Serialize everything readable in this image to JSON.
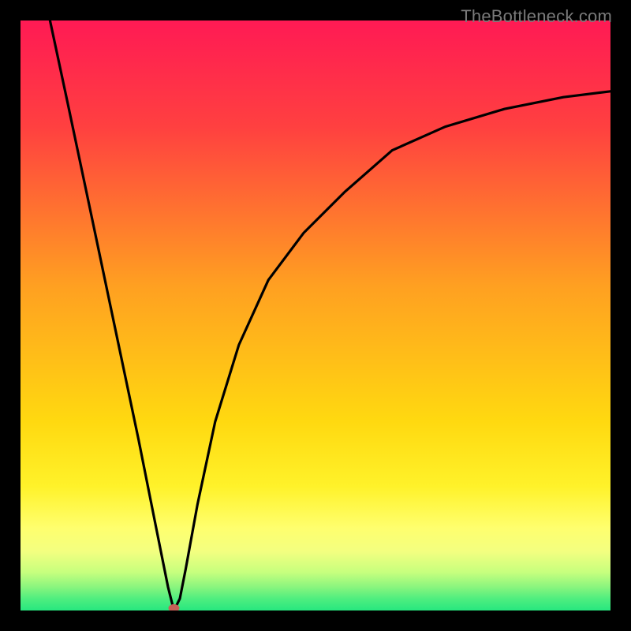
{
  "watermark": "TheBottleneck.com",
  "colors": {
    "frame": "#000000",
    "top_gradient": "#ff1a54",
    "mid_gradient": "#ffbf00",
    "yellow_hi": "#ffff6e",
    "green": "#27e77f",
    "curve": "#000000",
    "marker": "#c76057"
  },
  "chart_data": {
    "type": "line",
    "title": "",
    "xlabel": "",
    "ylabel": "",
    "xlim": [
      0,
      100
    ],
    "ylim": [
      0,
      100
    ],
    "grid": false,
    "legend": false,
    "notes": "Bottleneck-style V curve on red→yellow→green vertical gradient. Minimum at x≈26 touching y=0. Axes/ticks not visible.",
    "curve": {
      "left": [
        {
          "x": 5,
          "y": 100
        },
        {
          "x": 8,
          "y": 86
        },
        {
          "x": 12,
          "y": 67
        },
        {
          "x": 16,
          "y": 48
        },
        {
          "x": 20,
          "y": 29
        },
        {
          "x": 23,
          "y": 14
        },
        {
          "x": 25,
          "y": 4
        },
        {
          "x": 26,
          "y": 0
        }
      ],
      "right": [
        {
          "x": 26,
          "y": 0
        },
        {
          "x": 27,
          "y": 2
        },
        {
          "x": 28,
          "y": 7
        },
        {
          "x": 30,
          "y": 18
        },
        {
          "x": 33,
          "y": 32
        },
        {
          "x": 37,
          "y": 45
        },
        {
          "x": 42,
          "y": 56
        },
        {
          "x": 48,
          "y": 65
        },
        {
          "x": 55,
          "y": 72
        },
        {
          "x": 63,
          "y": 78
        },
        {
          "x": 72,
          "y": 82
        },
        {
          "x": 82,
          "y": 85
        },
        {
          "x": 92,
          "y": 87
        },
        {
          "x": 100,
          "y": 88
        }
      ]
    },
    "marker": {
      "x": 26,
      "y": 0
    }
  }
}
